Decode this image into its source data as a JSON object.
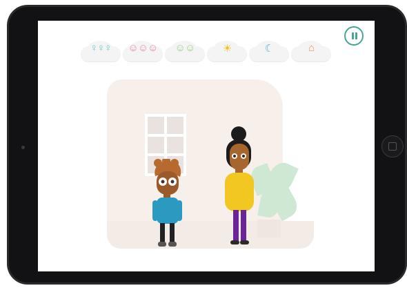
{
  "screen": {
    "categories": [
      {
        "name": "family",
        "glyph": "♀♀♀",
        "color": "#6cc9c6"
      },
      {
        "name": "friends",
        "glyph": "☺☺☺",
        "color": "#e98aa6"
      },
      {
        "name": "feelings",
        "glyph": "☺☺",
        "color": "#9ccf8a"
      },
      {
        "name": "activities",
        "glyph": "☀",
        "color": "#f2c21b"
      },
      {
        "name": "bedtime",
        "glyph": "☾",
        "color": "#5fb1dc"
      },
      {
        "name": "school",
        "glyph": "⌂",
        "color": "#f0925a"
      }
    ],
    "colors": {
      "tablet_frame": "#2a2a2c",
      "pause_accent": "#4aa494",
      "room_wall": "#f6efea",
      "boy_shirt": "#2b9ac0",
      "boy_hair": "#b66a2d",
      "woman_top": "#f3c722",
      "woman_pants": "#6a2497"
    }
  }
}
